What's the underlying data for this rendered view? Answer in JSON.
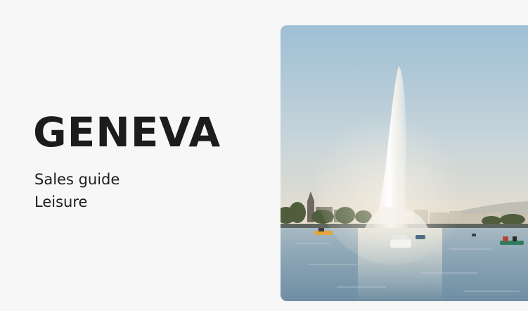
{
  "cover": {
    "title": "GENEVA",
    "subtitle_line1": "Sales guide",
    "subtitle_line2": "Leisure"
  },
  "photo": {
    "subject": "Jet d'Eau fountain on Lake Geneva with pedal boats",
    "colors": {
      "sky_top": "#9ec0d6",
      "sky_horizon": "#e7e1d3",
      "water": "#93adbd",
      "trees": "#4e5d3a",
      "buildings": "#c9c2b3"
    }
  },
  "theme": {
    "background": "#f7f7f7",
    "text": "#1c1c1c"
  }
}
